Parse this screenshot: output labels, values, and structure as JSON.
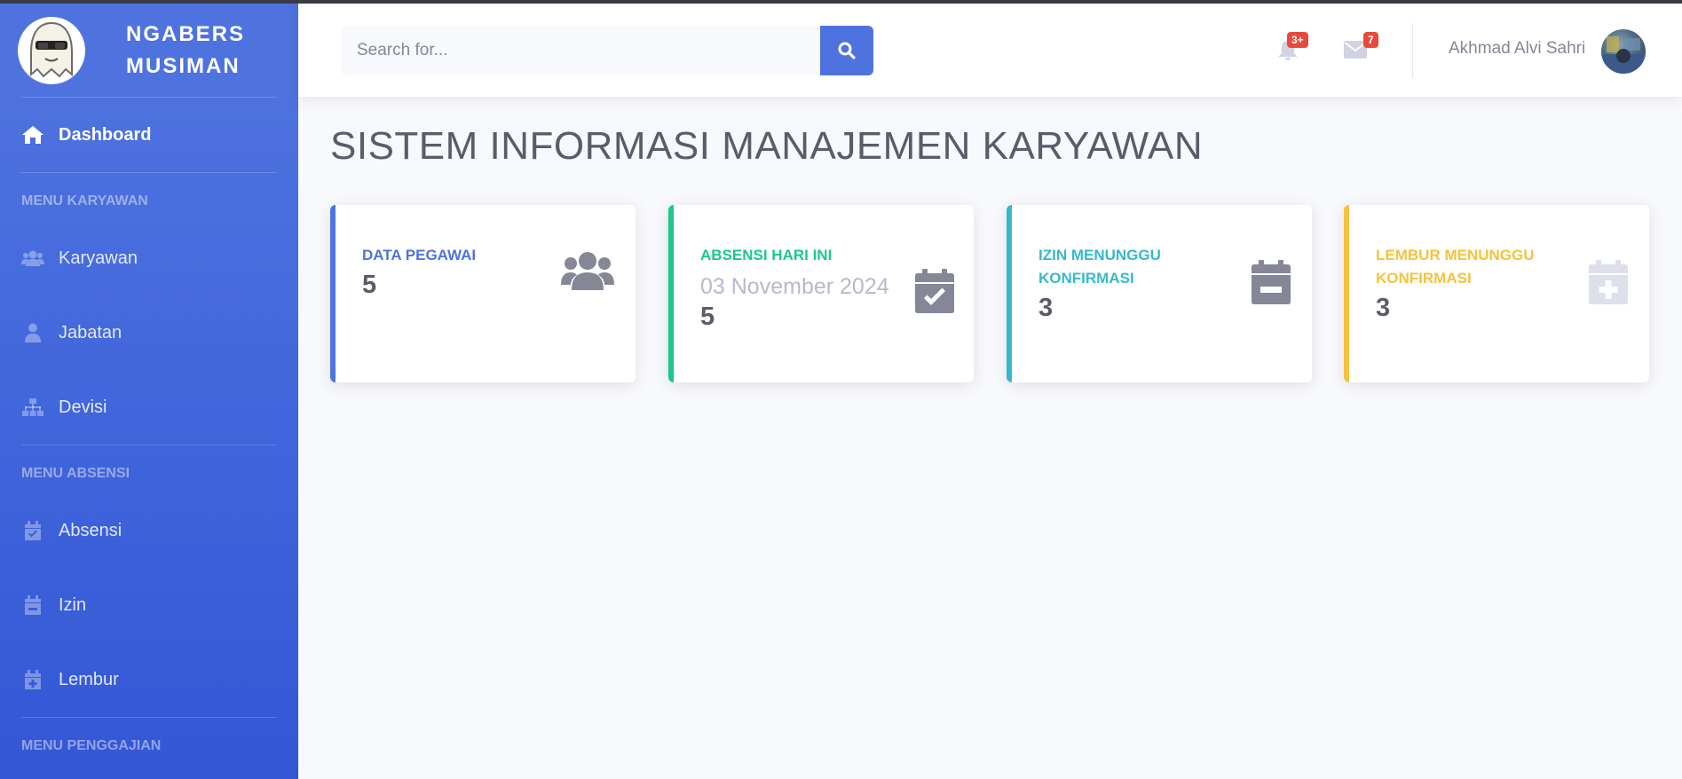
{
  "brand": {
    "name": "NGABERS MUSIMAN"
  },
  "sidebar": {
    "dashboard": "Dashboard",
    "heading_karyawan": "MENU KARYAWAN",
    "karyawan": "Karyawan",
    "jabatan": "Jabatan",
    "devisi": "Devisi",
    "heading_absensi": "MENU ABSENSI",
    "absensi": "Absensi",
    "izin": "Izin",
    "lembur": "Lembur",
    "heading_penggajian": "MENU PENGGAJIAN"
  },
  "topbar": {
    "search_placeholder": "Search for...",
    "alerts_badge": "3+",
    "messages_badge": "7",
    "user_name": "Akhmad Alvi Sahri"
  },
  "page": {
    "title": "SISTEM INFORMASI MANAJEMEN KARYAWAN"
  },
  "cards": [
    {
      "label": "DATA PEGAWAI",
      "value": "5",
      "color": "#4e73df",
      "icon": "users-icon"
    },
    {
      "label": "ABSENSI HARI INI",
      "date": "03 November 2024",
      "value": "5",
      "color": "#1cc88a",
      "icon": "calendar-check-icon"
    },
    {
      "label": "IZIN MENUNGGU KONFIRMASI",
      "value": "3",
      "color": "#36b9cc",
      "icon": "calendar-minus-icon"
    },
    {
      "label": "LEMBUR MENUNGGU KONFIRMASI",
      "value": "3",
      "color": "#f6c23e",
      "icon": "calendar-plus-icon"
    }
  ]
}
